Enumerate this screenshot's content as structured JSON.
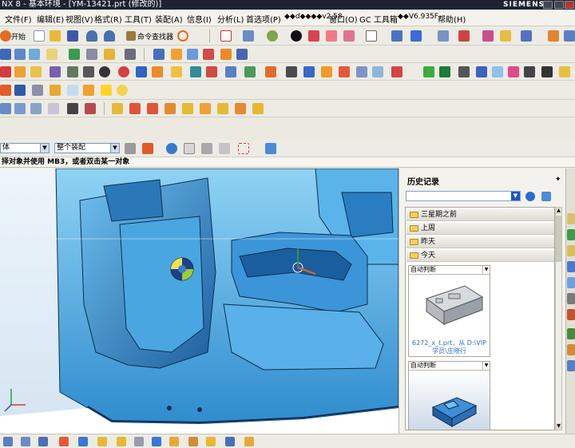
{
  "window": {
    "title": "NX 8 - 基本环境 - [YM-13421.prt (修改的)]",
    "brand": "SIEMENS"
  },
  "menubar": {
    "items": [
      "文件(F)",
      "编辑(E)",
      "视图(V)",
      "格式(R)",
      "工具(T)",
      "装配(A)",
      "信息(I)",
      "分析(L)",
      "首选项(P)",
      "◆◆d◆◆◆◆v2.58",
      "窗口(O)",
      "GC 工具箱",
      "◆◆V6.935F",
      "帮助(H)"
    ]
  },
  "toolbar": {
    "start_label": "开始",
    "command_finder_label": "命令查找器"
  },
  "selection": {
    "filter_value": "体",
    "scope_value": "整个装配"
  },
  "cue_line": "择对象并使用 MB3，或者双击某一对象",
  "history": {
    "title": "历史记录",
    "groups": [
      "三星期之前",
      "上周",
      "昨天",
      "今天"
    ],
    "cards": [
      {
        "mode": "自动判断",
        "caption": "6272_x_t.prt，从 D:\\VIP学员\\庄晓行"
      },
      {
        "mode": "自动判断",
        "caption": ""
      }
    ]
  },
  "icons": [
    "start-icon",
    "new-file-icon",
    "open-folder-icon",
    "save-icon",
    "undo-icon",
    "redo-icon",
    "command-finder-icon",
    "refresh-icon",
    "fit-view-icon",
    "rotate-view-icon",
    "shaded-icon",
    "wireframe-icon",
    "section-view-icon",
    "color-icon",
    "layer-icon",
    "datum-plane-icon",
    "move-object-icon",
    "pin-icon",
    "history-search-icon",
    "history-view-icon",
    "folder-icon"
  ]
}
